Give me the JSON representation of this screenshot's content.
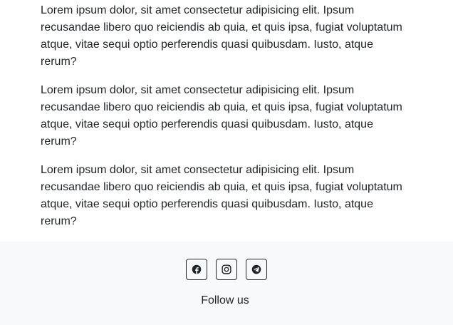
{
  "content": {
    "paragraphs": [
      "Lorem ipsum dolor, sit amet consectetur adipisicing elit. Ipsum recusandae libero quo reiciendis ab quia, et quis ipsa, fugiat voluptatum atque, vitae sequi optio perferendis quasi quibusdam. Iusto, atque rerum?",
      "Lorem ipsum dolor, sit amet consectetur adipisicing elit. Ipsum recusandae libero quo reiciendis ab quia, et quis ipsa, fugiat voluptatum atque, vitae sequi optio perferendis quasi quibusdam. Iusto, atque rerum?",
      "Lorem ipsum dolor, sit amet consectetur adipisicing elit. Ipsum recusandae libero quo reiciendis ab quia, et quis ipsa, fugiat voluptatum atque, vitae sequi optio perferendis quasi quibusdam. Iusto, atque rerum?"
    ]
  },
  "footer": {
    "social_icons": [
      "facebook-icon",
      "instagram-icon",
      "telegram-icon"
    ],
    "follow_text": "Follow us"
  },
  "colors": {
    "text": "#212529",
    "footer_background": "#f8f9fa",
    "page_background": "#ffffff"
  }
}
